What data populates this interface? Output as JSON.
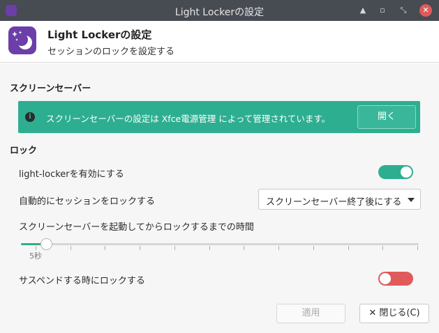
{
  "window": {
    "title": "Light Lockerの設定",
    "minimize_glyph": "▲",
    "maximize_glyph": "▫",
    "restore_glyph": "⤡",
    "close_glyph": "✕"
  },
  "header": {
    "title": "Light Lockerの設定",
    "subtitle": "セッションのロックを設定する",
    "icon": "moon-stars-icon"
  },
  "screensaver": {
    "section_title": "スクリーンセーバー",
    "info_text": "スクリーンセーバーの設定は Xfce電源管理 によって管理されています。",
    "info_icon_glyph": "i",
    "open_button": "開く"
  },
  "lock": {
    "section_title": "ロック",
    "enable_label": "light-lockerを有効にする",
    "enable_on": true,
    "auto_lock_label": "自動的にセッションをロックする",
    "auto_lock_selected": "スクリーンセーバー終了後にする",
    "delay_label": "スクリーンセーバーを起動してからロックするまでの時間",
    "delay_value": "5秒",
    "delay_fraction": 0.03,
    "suspend_label": "サスペンドする時にロックする",
    "suspend_on": false
  },
  "buttons": {
    "apply": "適用",
    "close": "✕ 閉じる(C)"
  },
  "colors": {
    "accent_green": "#2eae91",
    "toggle_off_red": "#e05a5a",
    "titlebar": "#474b52",
    "app_icon_purple": "#6b3ea8"
  }
}
